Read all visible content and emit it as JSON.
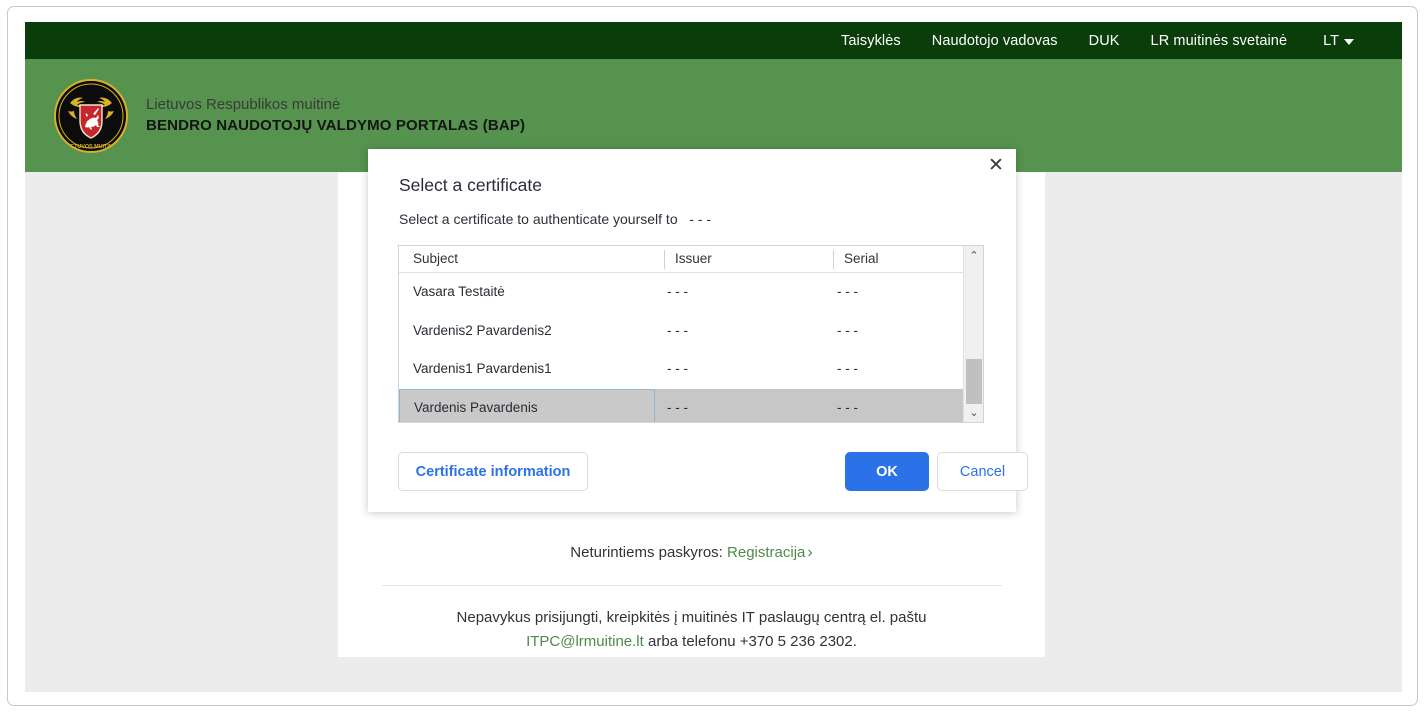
{
  "colors": {
    "topbar_green": "#0b3d0b",
    "brand_green": "#55934f",
    "page_gray": "#ececec",
    "link_green": "#4f8a4a",
    "accent_blue": "#2b72e8",
    "selected_row_gray": "#c7c7c7",
    "logo_gold": "#d9b227",
    "logo_black": "#0c0c0c",
    "shield_red": "#c8262c"
  },
  "topnav": {
    "links": [
      {
        "label": "Taisyklės",
        "name": "nav-taisykles"
      },
      {
        "label": "Naudotojo vadovas",
        "name": "nav-naudotojo-vadovas"
      },
      {
        "label": "DUK",
        "name": "nav-duk"
      },
      {
        "label": "LR muitinės svetainė",
        "name": "nav-lr-muitines-svetaine"
      }
    ],
    "language": "LT"
  },
  "brand": {
    "logo_ring_text": "LIETUVOS MUITINĖ",
    "line1": "Lietuvos Respublikos muitinė",
    "line2": "BENDRO NAUDOTOJŲ VALDYMO PORTALAS (BAP)"
  },
  "dialog": {
    "title": "Select a certificate",
    "subtitle": "Select a certificate to authenticate yourself to   - - -",
    "close_label": "✕",
    "columns": [
      {
        "label": "Subject"
      },
      {
        "label": "Issuer"
      },
      {
        "label": "Serial"
      }
    ],
    "rows": [
      {
        "subject": "Vasara Testaitė",
        "issuer": "- - -",
        "serial": "- - -",
        "selected": false
      },
      {
        "subject": "Vardenis2 Pavardenis2",
        "issuer": "- - -",
        "serial": "- - -",
        "selected": false
      },
      {
        "subject": "Vardenis1 Pavardenis1",
        "issuer": "- - -",
        "serial": "- - -",
        "selected": false
      },
      {
        "subject": "Vardenis Pavardenis",
        "issuer": "- - -",
        "serial": "- - -",
        "selected": true
      }
    ],
    "scrollbar": {
      "up_glyph": "⌃",
      "down_glyph": "⌄"
    },
    "buttons": {
      "certificate_information": "Certificate information",
      "ok": "OK",
      "cancel": "Cancel"
    }
  },
  "card": {
    "registration_prefix": "Neturintiems paskyros:",
    "registration_link": "Registracija",
    "registration_chevron": "›",
    "support_line1": "Nepavykus prisijungti, kreipkitės į muitinės IT paslaugų centrą el. paštu",
    "support_email": "ITPC@lrmuitine.lt",
    "support_line2_tail": " arba telefonu +370 5 236 2302."
  }
}
